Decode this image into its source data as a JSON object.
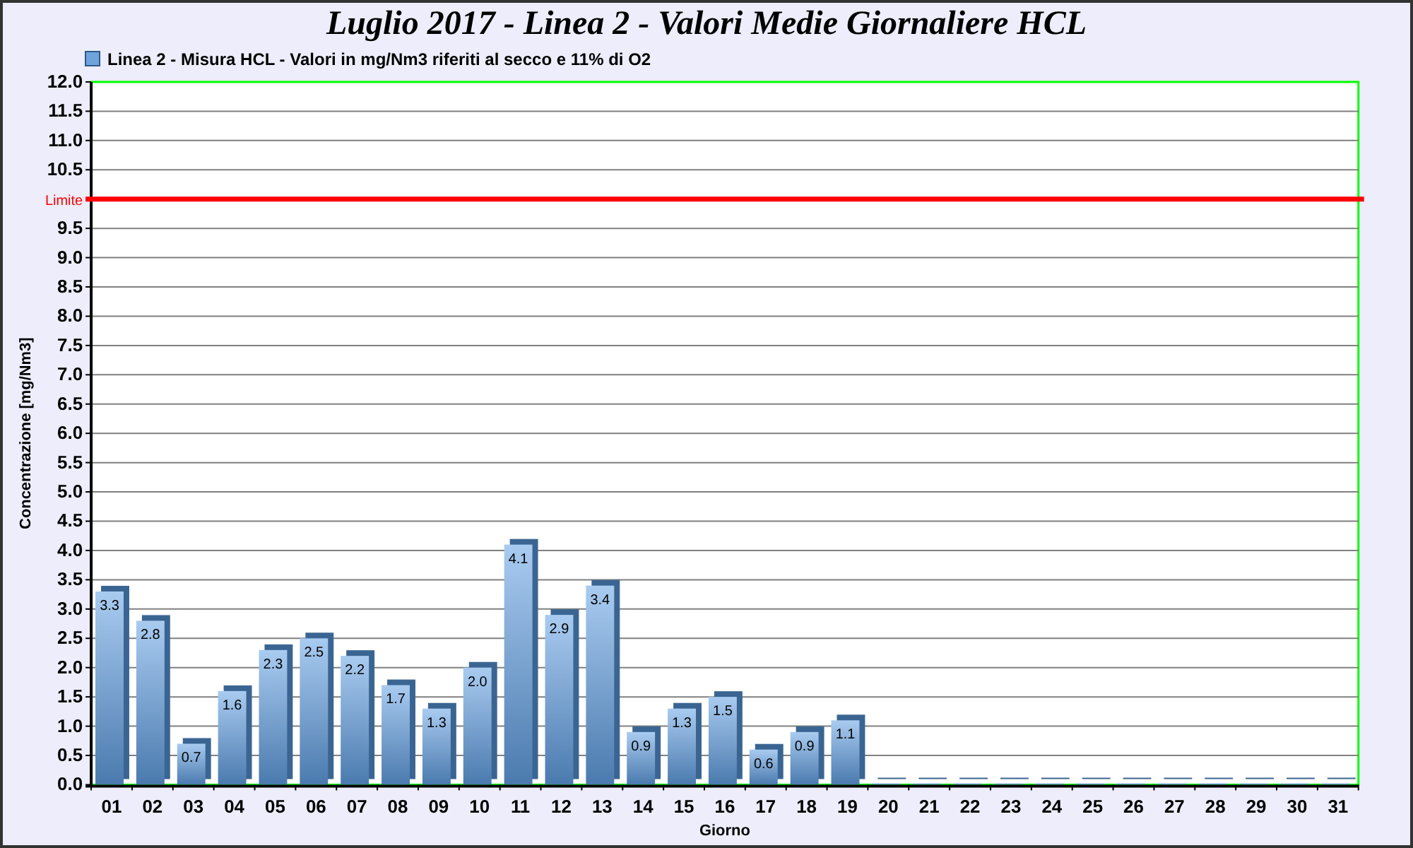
{
  "chart": {
    "chart_data": {
      "type": "bar",
      "title": "Luglio 2017 - Linea 2 - Valori Medie Giornaliere HCL",
      "xlabel": "Giorno",
      "ylabel": "Concentrazione [mg/Nm3]",
      "categories": [
        "01",
        "02",
        "03",
        "04",
        "05",
        "06",
        "07",
        "08",
        "09",
        "10",
        "11",
        "12",
        "13",
        "14",
        "15",
        "16",
        "17",
        "18",
        "19",
        "20",
        "21",
        "22",
        "23",
        "24",
        "25",
        "26",
        "27",
        "28",
        "29",
        "30",
        "31"
      ],
      "series": [
        {
          "name": "Linea 2 - Misura HCL - Valori in mg/Nm3 riferiti al secco e 11% di O2",
          "color": "#6fa3dc",
          "values": [
            3.3,
            2.8,
            0.7,
            1.6,
            2.3,
            2.5,
            2.2,
            1.7,
            1.3,
            2.0,
            4.1,
            2.9,
            3.4,
            0.9,
            1.3,
            1.5,
            0.6,
            0.9,
            1.1,
            0,
            0,
            0,
            0,
            0,
            0,
            0,
            0,
            0,
            0,
            0,
            0
          ]
        }
      ],
      "value_labels": [
        "3.3",
        "2.8",
        "0.7",
        "1.6",
        "2.3",
        "2.5",
        "2.2",
        "1.7",
        "1.3",
        "2.0",
        "4.1",
        "2.9",
        "3.4",
        "0.9",
        "1.3",
        "1.5",
        "0.6",
        "0.9",
        "1.1",
        null,
        null,
        null,
        null,
        null,
        null,
        null,
        null,
        null,
        null,
        null,
        null
      ],
      "ylim": [
        0,
        12
      ],
      "yticks": [
        {
          "value": 0,
          "label": "0.0"
        },
        {
          "value": 0.5,
          "label": "0.5"
        },
        {
          "value": 1,
          "label": "1.0"
        },
        {
          "value": 1.5,
          "label": "1.5"
        },
        {
          "value": 2,
          "label": "2.0"
        },
        {
          "value": 2.5,
          "label": "2.5"
        },
        {
          "value": 3,
          "label": "3.0"
        },
        {
          "value": 3.5,
          "label": "3.5"
        },
        {
          "value": 4,
          "label": "4.0"
        },
        {
          "value": 4.5,
          "label": "4.5"
        },
        {
          "value": 5,
          "label": "5.0"
        },
        {
          "value": 5.5,
          "label": "5.5"
        },
        {
          "value": 6,
          "label": "6.0"
        },
        {
          "value": 6.5,
          "label": "6.5"
        },
        {
          "value": 7,
          "label": "7.0"
        },
        {
          "value": 7.5,
          "label": "7.5"
        },
        {
          "value": 8,
          "label": "8.0"
        },
        {
          "value": 8.5,
          "label": "8.5"
        },
        {
          "value": 9,
          "label": "9.0"
        },
        {
          "value": 9.5,
          "label": "9.5"
        },
        {
          "value": 10.5,
          "label": "10.5"
        },
        {
          "value": 11,
          "label": "11.0"
        },
        {
          "value": 11.5,
          "label": "11.5"
        },
        {
          "value": 12,
          "label": "12.0"
        }
      ],
      "grid": true,
      "ref_lines": [
        {
          "axis": "y",
          "value": 10,
          "label": "Limite",
          "color": "#ff0000"
        }
      ]
    }
  }
}
